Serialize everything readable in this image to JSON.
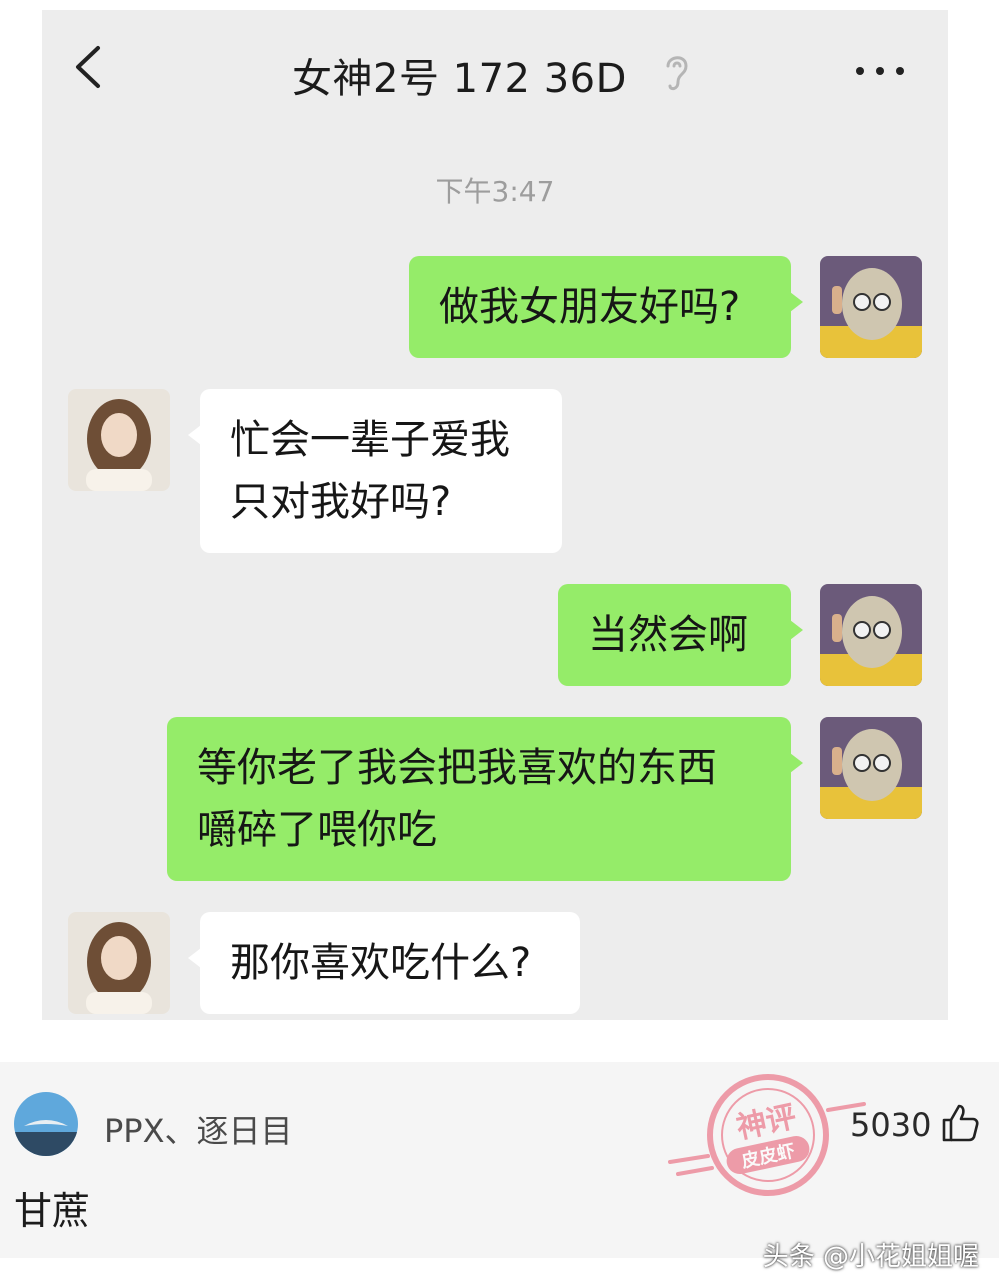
{
  "header": {
    "title": "女神2号 172  36D",
    "back_icon": "chevron-left-icon",
    "ear_icon": "ear-icon",
    "more_icon": "more-dots-icon"
  },
  "timestamp": "下午3:47",
  "messages": [
    {
      "side": "me",
      "lines": [
        "做我女朋友好吗?"
      ]
    },
    {
      "side": "them",
      "lines": [
        "忙会一辈子爱我",
        "只对我好吗?"
      ]
    },
    {
      "side": "me",
      "lines": [
        "当然会啊"
      ]
    },
    {
      "side": "me",
      "lines": [
        "等你老了我会把我喜欢的东西",
        "嚼碎了喂你吃"
      ]
    },
    {
      "side": "them",
      "lines": [
        "那你喜欢吃什么?"
      ]
    }
  ],
  "comment": {
    "username": "PPX、逐日目",
    "text": "甘蔗",
    "likes": "5030",
    "like_icon": "thumbs-up-icon"
  },
  "stamp": {
    "line1": "神评",
    "line2": "皮皮虾"
  },
  "watermark": "头条 @小花姐姐喔",
  "colors": {
    "my_bubble": "#95ec69",
    "their_bubble": "#ffffff",
    "chat_bg": "#ededed",
    "stamp": "#e8536a"
  }
}
